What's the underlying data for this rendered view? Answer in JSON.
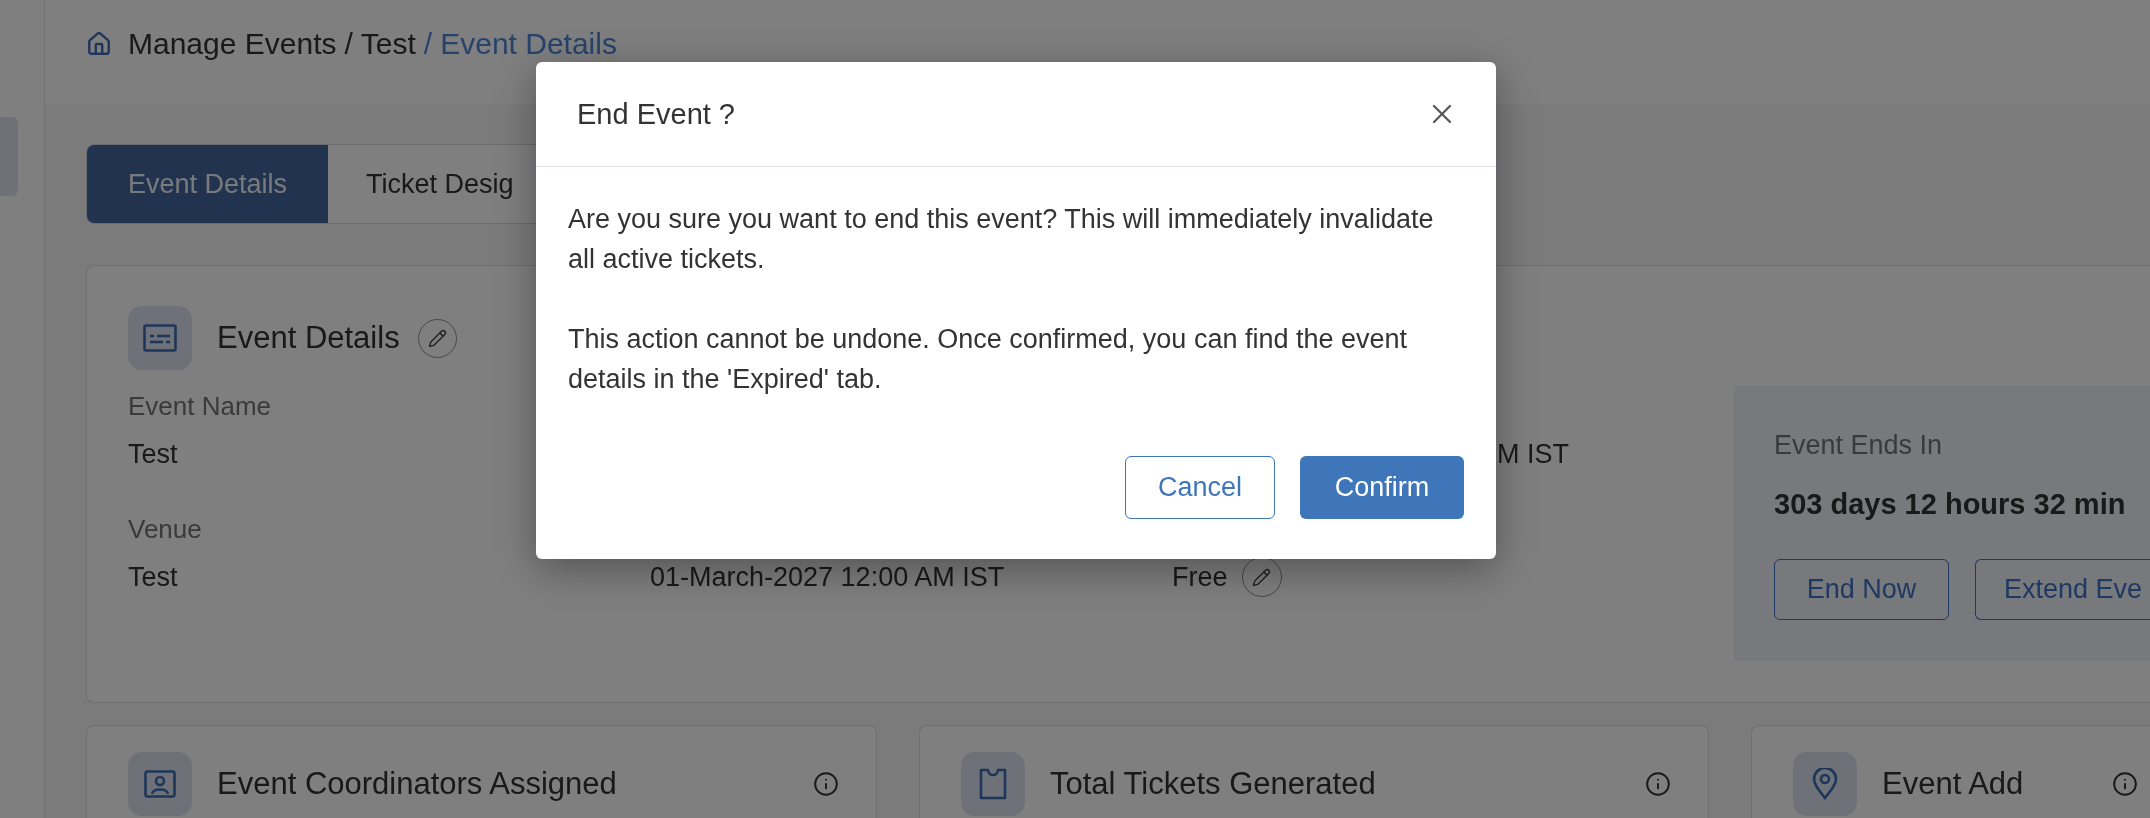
{
  "sidebar": {
    "items": [
      {
        "selected": true
      }
    ]
  },
  "breadcrumb": {
    "separator": "/",
    "items": [
      {
        "label": "Manage Events",
        "current": false
      },
      {
        "label": "Test",
        "current": false
      },
      {
        "label": "Event Details",
        "current": true
      }
    ]
  },
  "tabs": [
    {
      "label": "Event Details",
      "selected": true
    },
    {
      "label": "Ticket Desig",
      "selected": false
    }
  ],
  "event_card": {
    "title": "Event Details",
    "editable": true,
    "columns": [
      {
        "fields": [
          {
            "label": "Event Name",
            "value": "Test",
            "editable": false
          },
          {
            "label": "Venue",
            "value": "Test",
            "editable": false
          }
        ]
      },
      {
        "fields": [
          {
            "value": "01-March-2027 12:00 AM IST",
            "editable": false
          }
        ]
      },
      {
        "fields": [
          {
            "value": "M IST",
            "editable": false
          },
          {
            "value": "Free",
            "editable": true
          }
        ]
      }
    ],
    "countdown": {
      "label": "Event Ends In",
      "value": "303 days 12 hours 32 min",
      "buttons": [
        "End Now",
        "Extend Eve"
      ]
    }
  },
  "summary_cards": [
    {
      "kind": "coordinators",
      "title": "Event Coordinators Assigned"
    },
    {
      "kind": "tickets",
      "title": "Total Tickets Generated"
    },
    {
      "kind": "address",
      "title": "Event Add"
    }
  ],
  "dialog": {
    "title": "End Event ?",
    "paragraphs": [
      "Are you sure you want to end this event? This will immediately invalidate all active tickets.",
      "This action cannot be undone. Once confirmed, you can find the event details in the 'Expired' tab."
    ],
    "buttons": [
      {
        "label": "Cancel",
        "kind": "secondary"
      },
      {
        "label": "Confirm",
        "kind": "primary"
      }
    ]
  }
}
